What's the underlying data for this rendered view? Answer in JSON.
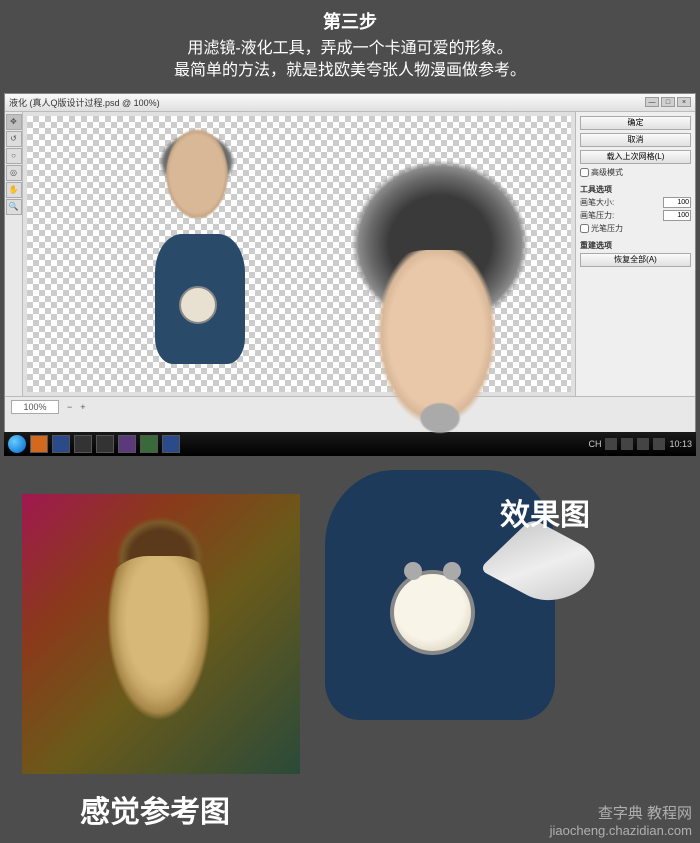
{
  "header": {
    "step_title": "第三步",
    "line1": "用滤镜-液化工具，弄成一个卡通可爱的形象。",
    "line2": "最简单的方法，就是找欧美夸张人物漫画做参考。"
  },
  "window": {
    "title": "液化 (真人Q版设计过程.psd @ 100%)",
    "controls": {
      "min": "—",
      "max": "□",
      "close": "×"
    },
    "zoom": "100%",
    "canvas_size": "100%"
  },
  "panel": {
    "btn_ok": "确定",
    "btn_cancel": "取消",
    "btn_load_mesh": "载入上次网格(L)",
    "chk_advanced": "高级模式",
    "section_tools": "工具选项",
    "brush_size_label": "画笔大小:",
    "brush_size_value": "100",
    "brush_pressure_label": "画笔压力:",
    "brush_pressure_value": "100",
    "chk_stylus": "光笔压力",
    "section_recon": "重建选项",
    "btn_restore_all": "恢复全部(A)"
  },
  "taskbar": {
    "time": "10:13",
    "lang": "CH"
  },
  "labels": {
    "result": "效果图",
    "reference": "感觉参考图"
  },
  "watermark": {
    "line1": "查字典 教程网",
    "line2": "jiaocheng.chazidian.com"
  }
}
